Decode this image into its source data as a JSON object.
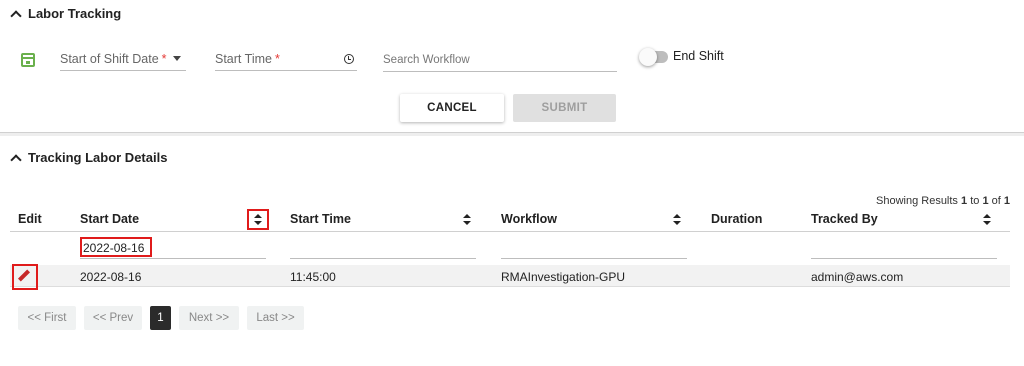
{
  "labor_tracking": {
    "title": "Labor Tracking",
    "shift_date_placeholder": "Start of Shift Date",
    "start_time_placeholder": "Start Time",
    "required_mark": "*",
    "search_placeholder": "Search Workflow",
    "end_shift_label": "End Shift",
    "end_shift_on": false,
    "cancel_label": "CANCEL",
    "submit_label": "SUBMIT"
  },
  "details": {
    "title": "Tracking Labor Details",
    "results": {
      "prefix": "Showing Results",
      "from": "1",
      "to_word": "to",
      "to": "1",
      "of_word": "of",
      "total": "1"
    },
    "columns": [
      "Edit",
      "Start Date",
      "Start Time",
      "Workflow",
      "Duration",
      "Tracked By"
    ],
    "filter_start_date": "2022-08-16",
    "rows": [
      {
        "start_date": "2022-08-16",
        "start_time": "11:45:00",
        "workflow": "RMAInvestigation-GPU",
        "duration": "",
        "tracked_by": "admin@aws.com"
      }
    ]
  },
  "pagination": {
    "first": "<< First",
    "prev": "<< Prev",
    "current": "1",
    "next": "Next >>",
    "last": "Last >>"
  },
  "colors": {
    "accent_green": "#6ab04c",
    "required_red": "#e53935",
    "highlight_red": "#e01b1b",
    "edit_icon": "#c62828"
  },
  "icons": {
    "calendar": "calendar-icon",
    "clock": "clock-icon",
    "edit": "pencil-icon",
    "sort": "sort-icon",
    "collapse": "chevron-up-icon"
  }
}
